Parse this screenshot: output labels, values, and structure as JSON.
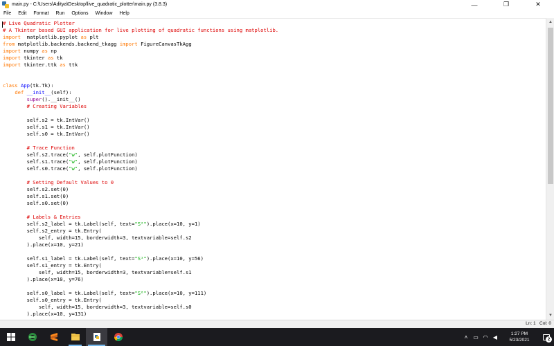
{
  "window": {
    "title": "main.py - C:\\Users\\Aditya\\Desktop\\live_quadratic_plotter\\main.py (3.8.3)",
    "controls": [
      "—",
      "❐",
      "✕"
    ]
  },
  "menu": [
    "File",
    "Edit",
    "Format",
    "Run",
    "Options",
    "Window",
    "Help"
  ],
  "code_lines": [
    [
      [
        "cm",
        "# Live Quadratic Plotter"
      ]
    ],
    [
      [
        "cm",
        "# A Tkinter based GUI application for live plotting of quadratic functions using matplotlib."
      ]
    ],
    [
      [
        "kw",
        "import"
      ],
      [
        "",
        "  matplotlib.pyplot "
      ],
      [
        "kw",
        "as"
      ],
      [
        "",
        " plt"
      ]
    ],
    [
      [
        "kw",
        "from"
      ],
      [
        "",
        " matplotlib.backends.backend_tkagg "
      ],
      [
        "kw",
        "import"
      ],
      [
        "",
        " FigureCanvasTkAgg"
      ]
    ],
    [
      [
        "kw",
        "import"
      ],
      [
        "",
        " numpy "
      ],
      [
        "kw",
        "as"
      ],
      [
        "",
        " np"
      ]
    ],
    [
      [
        "kw",
        "import"
      ],
      [
        "",
        " tkinter "
      ],
      [
        "kw",
        "as"
      ],
      [
        "",
        " tk"
      ]
    ],
    [
      [
        "kw",
        "import"
      ],
      [
        "",
        " tkinter.ttk "
      ],
      [
        "kw",
        "as"
      ],
      [
        "",
        " ttk"
      ]
    ],
    [],
    [],
    [
      [
        "kw",
        "class"
      ],
      [
        "df",
        " App"
      ],
      [
        "",
        "(tk.Tk):"
      ]
    ],
    [
      [
        "",
        "    "
      ],
      [
        "kw",
        "def"
      ],
      [
        "df",
        " __init__"
      ],
      [
        "",
        "(self):"
      ]
    ],
    [
      [
        "",
        "        "
      ],
      [
        "bi",
        "super"
      ],
      [
        "",
        "().__init__()"
      ]
    ],
    [
      [
        "",
        "        "
      ],
      [
        "cm",
        "# Creating Variables"
      ]
    ],
    [],
    [
      [
        "",
        "        self.s2 = tk.IntVar()"
      ]
    ],
    [
      [
        "",
        "        self.s1 = tk.IntVar()"
      ]
    ],
    [
      [
        "",
        "        self.s0 = tk.IntVar()"
      ]
    ],
    [],
    [
      [
        "",
        "        "
      ],
      [
        "cm",
        "# Trace Function"
      ]
    ],
    [
      [
        "",
        "        self.s2.trace("
      ],
      [
        "st",
        "\"w\""
      ],
      [
        "",
        ", self.plotFunction)"
      ]
    ],
    [
      [
        "",
        "        self.s1.trace("
      ],
      [
        "st",
        "\"w\""
      ],
      [
        "",
        ", self.plotFunction)"
      ]
    ],
    [
      [
        "",
        "        self.s0.trace("
      ],
      [
        "st",
        "\"w\""
      ],
      [
        "",
        ", self.plotFunction)"
      ]
    ],
    [],
    [
      [
        "",
        "        "
      ],
      [
        "cm",
        "# Setting Default Values to 0"
      ]
    ],
    [
      [
        "",
        "        self.s2.set(0)"
      ]
    ],
    [
      [
        "",
        "        self.s1.set(0)"
      ]
    ],
    [
      [
        "",
        "        self.s0.set(0)"
      ]
    ],
    [],
    [
      [
        "",
        "        "
      ],
      [
        "cm",
        "# Labels & Entries"
      ]
    ],
    [
      [
        "",
        "        self.s2_label = tk.Label(self, text="
      ],
      [
        "st",
        "\"S²\""
      ],
      [
        "",
        ").place(x=10, y=1)"
      ]
    ],
    [
      [
        "",
        "        self.s2_entry = tk.Entry("
      ]
    ],
    [
      [
        "",
        "            self, width=15, borderwidth=3, textvariable=self.s2"
      ]
    ],
    [
      [
        "",
        "        ).place(x=10, y=21)"
      ]
    ],
    [],
    [
      [
        "",
        "        self.s1_label = tk.Label(self, text="
      ],
      [
        "st",
        "\"S¹\""
      ],
      [
        "",
        ").place(x=10, y=56)"
      ]
    ],
    [
      [
        "",
        "        self.s1_entry = tk.Entry("
      ]
    ],
    [
      [
        "",
        "            self, width=15, borderwidth=3, textvariable=self.s1"
      ]
    ],
    [
      [
        "",
        "        ).place(x=10, y=76)"
      ]
    ],
    [],
    [
      [
        "",
        "        self.s0_label = tk.Label(self, text="
      ],
      [
        "st",
        "\"S⁰\""
      ],
      [
        "",
        ").place(x=10, y=111)"
      ]
    ],
    [
      [
        "",
        "        self.s0_entry = tk.Entry("
      ]
    ],
    [
      [
        "",
        "            self, width=15, borderwidth=3, textvariable=self.s0"
      ]
    ],
    [
      [
        "",
        "        ).place(x=10, y=131)"
      ]
    ]
  ],
  "status": {
    "text": "Ln: 1   Col: 0"
  },
  "taskbar": {
    "apps": [
      "start-icon",
      "edge-icon",
      "sublime-icon",
      "file-explorer-icon",
      "python-idle-icon",
      "chrome-icon"
    ],
    "time": "1:27 PM",
    "date": "5/23/2021",
    "notifications": "2"
  }
}
